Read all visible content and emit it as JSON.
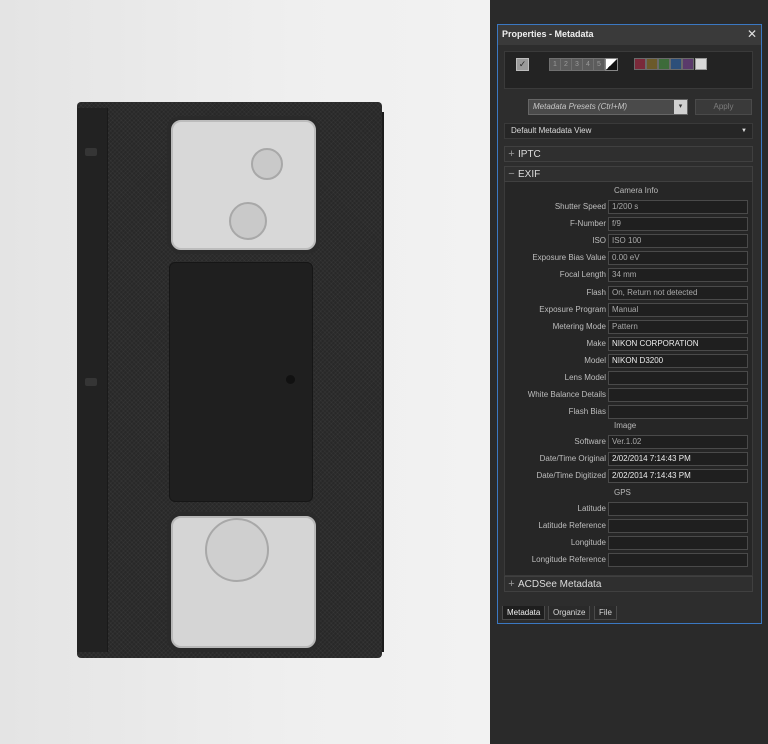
{
  "panel": {
    "title": "Properties - Metadata",
    "close_glyph": "✕"
  },
  "toolbox": {
    "checkmark_glyph": "✓",
    "numbers": [
      "1",
      "2",
      "3",
      "4",
      "5"
    ],
    "colors": [
      "#7a2a3a",
      "#6b5a2a",
      "#3d6b3a",
      "#2d4f7a",
      "#5a3a6b"
    ]
  },
  "presets": {
    "placeholder": "Metadata Presets (Ctrl+M)",
    "arrow_glyph": "▾",
    "apply_label": "Apply"
  },
  "view": {
    "label": "Default Metadata View",
    "arrow_glyph": "▼"
  },
  "sections": {
    "iptc": {
      "symbol": "+",
      "label": "IPTC"
    },
    "exif": {
      "symbol": "−",
      "label": "EXIF"
    },
    "acdsee": {
      "symbol": "+",
      "label": "ACDSee Metadata"
    }
  },
  "exif": {
    "camera_info_label": "Camera Info",
    "image_label": "Image",
    "gps_label": "GPS",
    "camera_rows": [
      {
        "label": "Shutter Speed",
        "value": "1/200 s",
        "bright": false
      },
      {
        "label": "F-Number",
        "value": "f/9",
        "bright": false
      },
      {
        "label": "ISO",
        "value": "ISO 100",
        "bright": false
      },
      {
        "label": "Exposure Bias Value",
        "value": "0.00 eV",
        "bright": false
      },
      {
        "label": "Focal Length",
        "value": "34 mm",
        "bright": false
      },
      {
        "label": "Flash",
        "value": "On, Return not detected",
        "bright": false
      },
      {
        "label": "Exposure Program",
        "value": "Manual",
        "bright": false
      },
      {
        "label": "Metering Mode",
        "value": "Pattern",
        "bright": false
      },
      {
        "label": "Make",
        "value": "NIKON CORPORATION",
        "bright": true
      },
      {
        "label": "Model",
        "value": "NIKON D3200",
        "bright": true
      },
      {
        "label": "Lens Model",
        "value": "",
        "bright": false
      },
      {
        "label": "White Balance Details",
        "value": "",
        "bright": false
      },
      {
        "label": "Flash Bias",
        "value": "",
        "bright": false
      }
    ],
    "image_rows": [
      {
        "label": "Software",
        "value": "Ver.1.02",
        "bright": false
      },
      {
        "label": "Date/Time Original",
        "value": "2/02/2014 7:14:43 PM",
        "bright": true
      },
      {
        "label": "Date/Time Digitized",
        "value": "2/02/2014 7:14:43 PM",
        "bright": true
      }
    ],
    "gps_rows": [
      {
        "label": "Latitude",
        "value": "",
        "bright": false
      },
      {
        "label": "Latitude Reference",
        "value": "",
        "bright": false
      },
      {
        "label": "Longitude",
        "value": "",
        "bright": false
      },
      {
        "label": "Longitude Reference",
        "value": "",
        "bright": false
      }
    ]
  },
  "tabs": [
    {
      "label": "Metadata",
      "active": true
    },
    {
      "label": "Organize",
      "active": false
    },
    {
      "label": "File",
      "active": false
    }
  ]
}
